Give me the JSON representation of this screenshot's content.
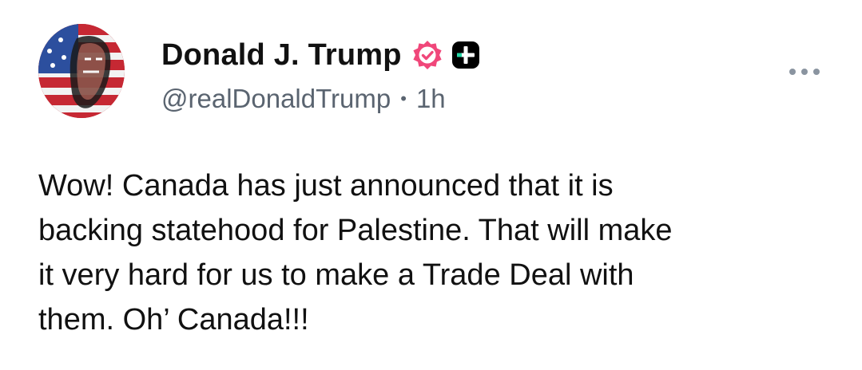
{
  "post": {
    "author": {
      "display_name": "Donald J. Trump",
      "handle": "@realDonaldTrump",
      "verified_icon": "verified-badge-icon",
      "extra_badge_icon": "plus-badge-icon",
      "avatar_icon": "flag-portrait-avatar"
    },
    "separator": "•",
    "timestamp": "1h",
    "more_icon": "more-options-icon",
    "text": "Wow! Canada has just announced that it is\nbacking statehood for Palestine. That will make\nit very hard for us to make a Trade Deal with\nthem. Oh’ Canada!!!"
  },
  "colors": {
    "verified_badge": "#f0477a",
    "plus_badge": "#000000",
    "plus_badge_accent": "#22d6a5",
    "secondary_text": "#5a6470"
  }
}
